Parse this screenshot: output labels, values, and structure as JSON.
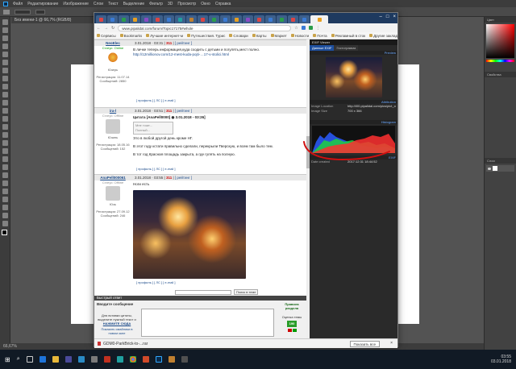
{
  "photoshop": {
    "menu": [
      "Файл",
      "Редактирование",
      "Изображение",
      "Слои",
      "Текст",
      "Выделение",
      "Фильтр",
      "3D",
      "Просмотр",
      "Окно",
      "Справка"
    ],
    "doc_tab": "Без имени-1 @ 66,7% (RGB/8)",
    "zoom_status": "66,67%",
    "right_panel_headers": [
      "Цвет",
      "Образцы",
      "Свойства",
      "Слои",
      "Каналы",
      "Контуры"
    ]
  },
  "browser": {
    "url": "www.pipalidal.com/forum/Topic17175#whole",
    "bookmarks": [
      "Сервисы",
      "Bookmarks",
      "Лучшие интернет-м",
      "Путешествия. Турис",
      "Словари",
      "Карты",
      "Маркет",
      "Новости",
      "Почта",
      "Рекламный в сток",
      "Другие закладки"
    ],
    "download_file": "GDM0-ParkBrick-to-...rar",
    "show_all": "Показать все"
  },
  "forum": {
    "posts": [
      {
        "author": "NeoElec",
        "date": "3.01.2018 · 03:31",
        "num": "311",
        "rating_link": "[ рейтинг ]",
        "status": "Статус: Online",
        "role": "Юзерь",
        "reg": "Регистрация: 11.07.14",
        "msgs": "Сообщений: 2850",
        "body": "В личке теперь информация,куда сходить с детьми и погулять,мест полно.",
        "link": "http://12millionov.com/12-mest-kuda-pojti-…17-v-stolici.html",
        "footer": "[ профиль ] [ ЛС ] [ e-mail ]"
      },
      {
        "author": "ira-l",
        "date": "3.01.2018 · 03:51",
        "num": "311",
        "rating_link": "[ рейтинг ]",
        "status": "Статус: Offline",
        "role": "Юзинь",
        "reg": "Регистрация: 18.05.16",
        "msgs": "Сообщений: 152",
        "quote_head": "Цитата [AnaPell0000] ◉ 3.01.2018 - 03:26]",
        "quote_lines": [
          "Мне тоже...",
          "Полный..."
        ],
        "body1": "Это в любой другой день кроме НГ.",
        "body2": "В этот году кстати правильно сделали, перекрыли Тверскую, и всем там было тем.",
        "body3": "В тот год Красная площадь закрыта, а где гулять на полную.",
        "footer": "[ профиль ] [ ЛС ] [ e-mail ]"
      },
      {
        "author": "AnaPell000061",
        "date": "3.01.2018 · 03:55",
        "num": "311",
        "rating_link": "[ рейтинг ]",
        "status": "Статус: Offline",
        "role": "Юзь",
        "reg": "Регистрация: 27.09.12",
        "msgs": "Сообщений: 246",
        "body": "Ноги есть",
        "footer": "[ профиль ] [ ЛС ] [ e-mail ]"
      }
    ],
    "search_btn": "Поиск в теме",
    "quick_reply_title": "Быстрый ответ",
    "reply_label": "Вводите сообщение",
    "insert_hint": "Для вставки цитаты, выделите нужный текст и",
    "insert_link": "НАЖМИТЕ СЮДА",
    "smileys_link": "Показать смайлики в новом окне",
    "rating_label": "Оценка темы",
    "rating_value": "190",
    "rules_label": "Правила раздела"
  },
  "exif": {
    "title": "EXIF Viewer",
    "tabs": [
      "Данные EXIF",
      "Гистограмма"
    ],
    "sections": [
      "Preview",
      "Attribution",
      "Histogram",
      "EXIF"
    ],
    "rows": [
      {
        "k": "Image Location",
        "v": "http://i00.pipalidal.com/pics/pict_origi..."
      },
      {
        "k": "Image Size",
        "v": "700 x 366"
      }
    ],
    "date_label": "Date created",
    "date_value": "2017:12:31 18:44:52"
  },
  "taskbar": {
    "time": "03:55",
    "date": "03.01.2018"
  }
}
